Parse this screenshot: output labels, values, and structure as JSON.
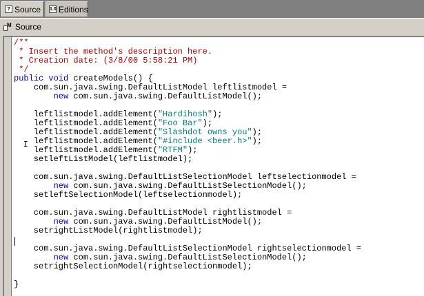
{
  "tabs": [
    {
      "label": "Source",
      "icon": "source-tab-icon",
      "active": true
    },
    {
      "label": "Editions",
      "icon": "editions-tab-icon",
      "active": false
    }
  ],
  "panel": {
    "title": "Source",
    "icon": "source-panel-icon"
  },
  "editor": {
    "lines": [
      [
        {
          "t": "/**",
          "c": "com"
        }
      ],
      [
        {
          "t": " * Insert the method's description here.",
          "c": "com"
        }
      ],
      [
        {
          "t": " * Creation date: (3/8/00 5:58:21 PM)",
          "c": "com"
        }
      ],
      [
        {
          "t": " */",
          "c": "com"
        }
      ],
      [
        {
          "t": "public",
          "c": "kw"
        },
        {
          "t": " "
        },
        {
          "t": "void",
          "c": "kw"
        },
        {
          "t": " createModels() {"
        }
      ],
      [
        {
          "t": "    com.sun.java.swing.DefaultListModel leftlistmodel ="
        }
      ],
      [
        {
          "t": "        "
        },
        {
          "t": "new",
          "c": "kw"
        },
        {
          "t": " com.sun.java.swing.DefaultListModel();"
        }
      ],
      [],
      [
        {
          "t": "    leftlistmodel.addElement("
        },
        {
          "t": "\"Hardihosh\"",
          "c": "str"
        },
        {
          "t": ");"
        }
      ],
      [
        {
          "t": "    leftlistmodel.addElement("
        },
        {
          "t": "\"Foo Bar\"",
          "c": "str"
        },
        {
          "t": ");"
        }
      ],
      [
        {
          "t": "    leftlistmodel.addElement("
        },
        {
          "t": "\"Slashdot owns you\"",
          "c": "str"
        },
        {
          "t": ");"
        }
      ],
      [
        {
          "t": "    leftlistmodel.addElement("
        },
        {
          "t": "\"#include <beer.h>\"",
          "c": "str"
        },
        {
          "t": ");"
        }
      ],
      [
        {
          "t": "    leftlistmodel.addElement("
        },
        {
          "t": "\"RTFM\"",
          "c": "str"
        },
        {
          "t": ");"
        }
      ],
      [
        {
          "t": "    setleftListModel(leftlistmodel);"
        }
      ],
      [],
      [
        {
          "t": "    com.sun.java.swing.DefaultListSelectionModel leftselectionmodel ="
        }
      ],
      [
        {
          "t": "        "
        },
        {
          "t": "new",
          "c": "kw"
        },
        {
          "t": " com.sun.java.swing.DefaultListSelectionModel();"
        }
      ],
      [
        {
          "t": "    setleftSelectionModel(leftselectionmodel);"
        }
      ],
      [],
      [
        {
          "t": "    com.sun.java.swing.DefaultListModel rightlistmodel ="
        }
      ],
      [
        {
          "t": "        "
        },
        {
          "t": "new",
          "c": "kw"
        },
        {
          "t": " com.sun.java.swing.DefaultListModel();"
        }
      ],
      [
        {
          "t": "    setrightListModel(rightlistmodel);"
        }
      ],
      [],
      [
        {
          "t": "    com.sun.java.swing.DefaultListSelectionModel rightselectionmodel ="
        }
      ],
      [
        {
          "t": "        "
        },
        {
          "t": "new",
          "c": "kw"
        },
        {
          "t": " com.sun.java.swing.DefaultListSelectionModel();"
        }
      ],
      [
        {
          "t": "    setrightSelectionModel(rightselectionmodel);"
        }
      ],
      [],
      [
        {
          "t": "}"
        }
      ]
    ]
  },
  "colors": {
    "keyword": "#0000c0",
    "string": "#008080",
    "comment": "#b00000",
    "chrome": "#d4d0c8",
    "tabstrip": "#808080"
  }
}
